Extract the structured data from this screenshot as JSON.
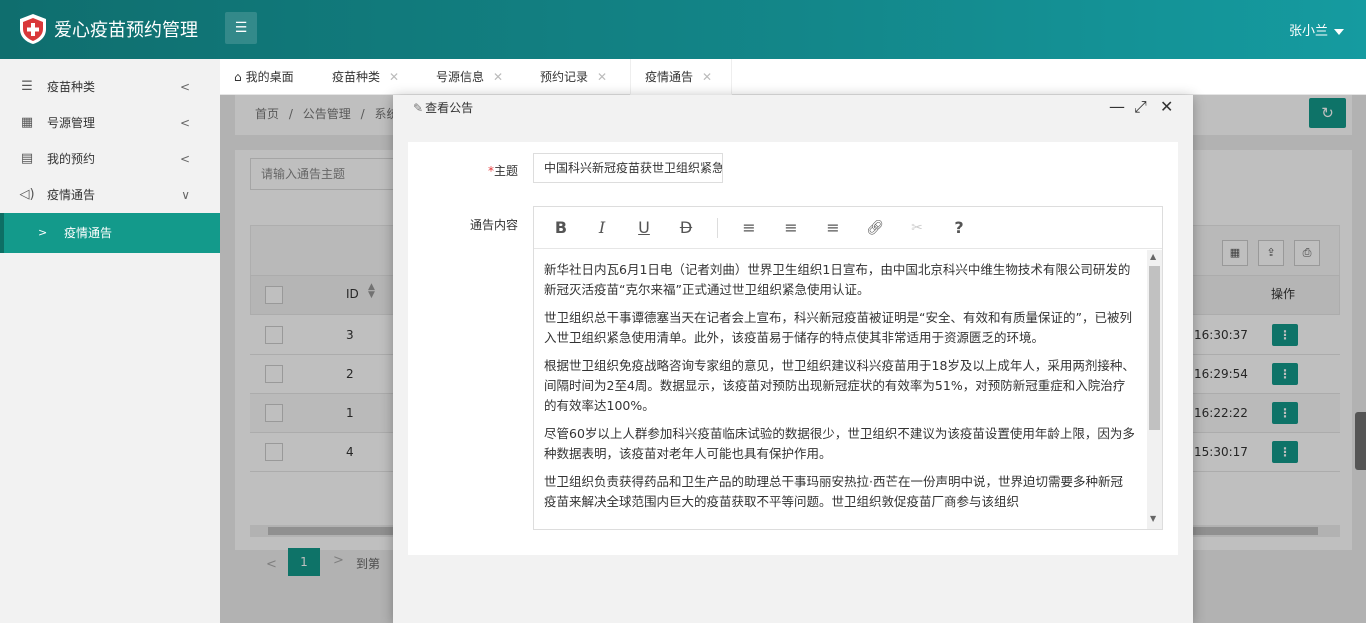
{
  "header": {
    "app_title": "爱心疫苗预约管理",
    "menu_icon": "hamburger-icon",
    "user_name": "张小兰"
  },
  "sidebar": {
    "items": [
      {
        "label": "疫苗种类",
        "icon": "list-icon"
      },
      {
        "label": "号源管理",
        "icon": "grid-icon"
      },
      {
        "label": "我的预约",
        "icon": "document-icon"
      },
      {
        "label": "疫情通告",
        "icon": "speaker-icon"
      }
    ],
    "sub_item": "疫情通告"
  },
  "tabs": [
    {
      "label": "我的桌面"
    },
    {
      "label": "疫苗种类"
    },
    {
      "label": "号源信息"
    },
    {
      "label": "预约记录"
    },
    {
      "label": "疫情通告"
    }
  ],
  "breadcrumb": [
    "首页",
    "/",
    "公告管理",
    "/",
    "系统"
  ],
  "search": {
    "placeholder": "请输入通告主题"
  },
  "table": {
    "col_id": "ID",
    "col_op": "操作",
    "rows": [
      {
        "id": "3",
        "time": "16:30:37"
      },
      {
        "id": "2",
        "time": "16:29:54"
      },
      {
        "id": "1",
        "time": "16:22:22"
      },
      {
        "id": "4",
        "time": "15:30:17"
      }
    ]
  },
  "pager": {
    "current": "1",
    "goto_label": "到第"
  },
  "modal": {
    "title": "查看公告",
    "subject_label": "主题",
    "subject_value": "中国科兴新冠疫苗获世卫组织紧急",
    "content_label": "通告内容",
    "paragraphs": [
      "新华社日内瓦6月1日电（记者刘曲）世界卫生组织1日宣布，由中国北京科兴中维生物技术有限公司研发的新冠灭活疫苗“克尔来福”正式通过世卫组织紧急使用认证。",
      "世卫组织总干事谭德塞当天在记者会上宣布，科兴新冠疫苗被证明是“安全、有效和有质量保证的”，已被列入世卫组织紧急使用清单。此外，该疫苗易于储存的特点使其非常适用于资源匮乏的环境。",
      "根据世卫组织免疫战略咨询专家组的意见，世卫组织建议科兴疫苗用于18岁及以上成年人，采用两剂接种、间隔时间为2至4周。数据显示，该疫苗对预防出现新冠症状的有效率为51%，对预防新冠重症和入院治疗的有效率达100%。",
      "尽管60岁以上人群参加科兴疫苗临床试验的数据很少，世卫组织不建议为该疫苗设置使用年龄上限，因为多种数据表明，该疫苗对老年人可能也具有保护作用。",
      "世卫组织负责获得药品和卫生产品的助理总干事玛丽安热拉·西芒在一份声明中说，世界迫切需要多种新冠疫苗来解决全球范围内巨大的疫苗获取不平等问题。世卫组织敦促疫苗厂商参与该组织"
    ]
  },
  "colors": {
    "accent": "#139a8b",
    "header_start": "#0f6e6e",
    "header_end": "#159ba0",
    "required": "#e4393c"
  }
}
